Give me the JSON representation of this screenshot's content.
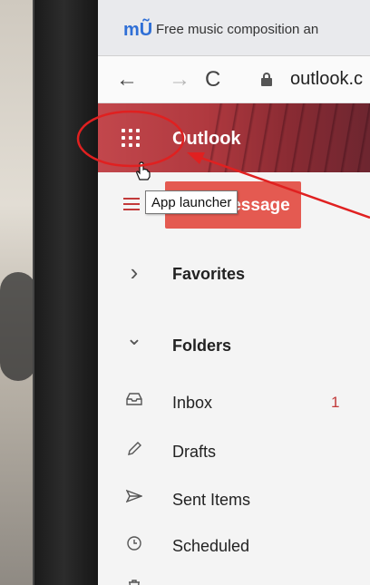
{
  "browser": {
    "tab_title": "Free music composition an",
    "url": "outlook.c",
    "back_glyph": "←",
    "forward_glyph": "→",
    "reload_glyph": "C"
  },
  "app": {
    "brand": "Outlook",
    "new_message_label": "New message",
    "tooltip": "App launcher"
  },
  "nav": {
    "sections": [
      {
        "label": "Favorites",
        "icon": "chevron-right-icon",
        "glyph": "›"
      },
      {
        "label": "Folders",
        "icon": "chevron-down-icon",
        "glyph": "⌄"
      }
    ],
    "folders": [
      {
        "label": "Inbox",
        "icon": "inbox-icon",
        "count": "1"
      },
      {
        "label": "Drafts",
        "icon": "pencil-icon",
        "count": ""
      },
      {
        "label": "Sent Items",
        "icon": "send-icon",
        "count": ""
      },
      {
        "label": "Scheduled",
        "icon": "clock-icon",
        "count": ""
      },
      {
        "label": "",
        "icon": "trash-icon",
        "count": ""
      }
    ]
  },
  "colors": {
    "header_red": "#b0393f",
    "accent_red": "#c23a3a",
    "button_red": "#e45a51",
    "annotation_red": "#e02020"
  }
}
